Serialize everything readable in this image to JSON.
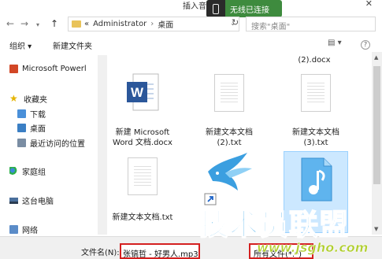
{
  "window": {
    "title": "插入音频",
    "close_glyph": "✕"
  },
  "toast": {
    "message": "无线已连接"
  },
  "nav": {
    "back_glyph": "←",
    "forward_glyph": "→",
    "up_glyph": "↑",
    "breadcrumb_prefix": "«",
    "path": [
      "Administrator",
      "桌面"
    ],
    "path_sep": "›",
    "dropdown_glyph": "⌄",
    "refresh_glyph": "↻",
    "search_placeholder": "搜索\"桌面\""
  },
  "toolbar": {
    "organize": "组织 ▾",
    "new_folder": "新建文件夹",
    "view_glyph": "▤ ▾",
    "help_glyph": "?"
  },
  "sidebar": {
    "items": [
      {
        "label": "Microsoft Powerl",
        "icon": "powerpoint-icon"
      },
      {
        "label": "收藏夹",
        "icon": "star-icon"
      },
      {
        "label": "下载",
        "icon": "download-folder-icon"
      },
      {
        "label": "桌面",
        "icon": "desktop-icon"
      },
      {
        "label": "最近访问的位置",
        "icon": "recent-places-icon"
      },
      {
        "label": "家庭组",
        "icon": "homegroup-icon"
      },
      {
        "label": "这台电脑",
        "icon": "computer-icon"
      },
      {
        "label": "网络",
        "icon": "network-icon"
      }
    ]
  },
  "files": [
    {
      "label": "(2).docx",
      "icon": "docx-icon"
    },
    {
      "label": "新建 Microsoft Word 文档.docx",
      "icon": "word-icon"
    },
    {
      "label": "新建文本文档 (2).txt",
      "icon": "txt-file-icon"
    },
    {
      "label": "新建文本文档 (3).txt",
      "icon": "txt-file-icon"
    },
    {
      "label": "新建文本文档.txt",
      "icon": "txt-file-icon"
    },
    {
      "label": "",
      "icon": "kugou-shortcut-icon"
    },
    {
      "label": "",
      "icon": "audio-file-icon"
    }
  ],
  "bottom": {
    "filename_label": "文件名(N):",
    "filename_value": "张镐哲 - 好男人.mp3",
    "filetype_value": "所有文件(*.*)"
  },
  "watermark": {
    "text": "技术员联盟",
    "url": "www.jsgho.com"
  },
  "colors": {
    "selection": "#cce8ff",
    "highlight_border": "#d42020",
    "toast_bg": "#3e8b3e",
    "word_blue": "#2b579a",
    "audio_blue": "#3aa0e8"
  }
}
